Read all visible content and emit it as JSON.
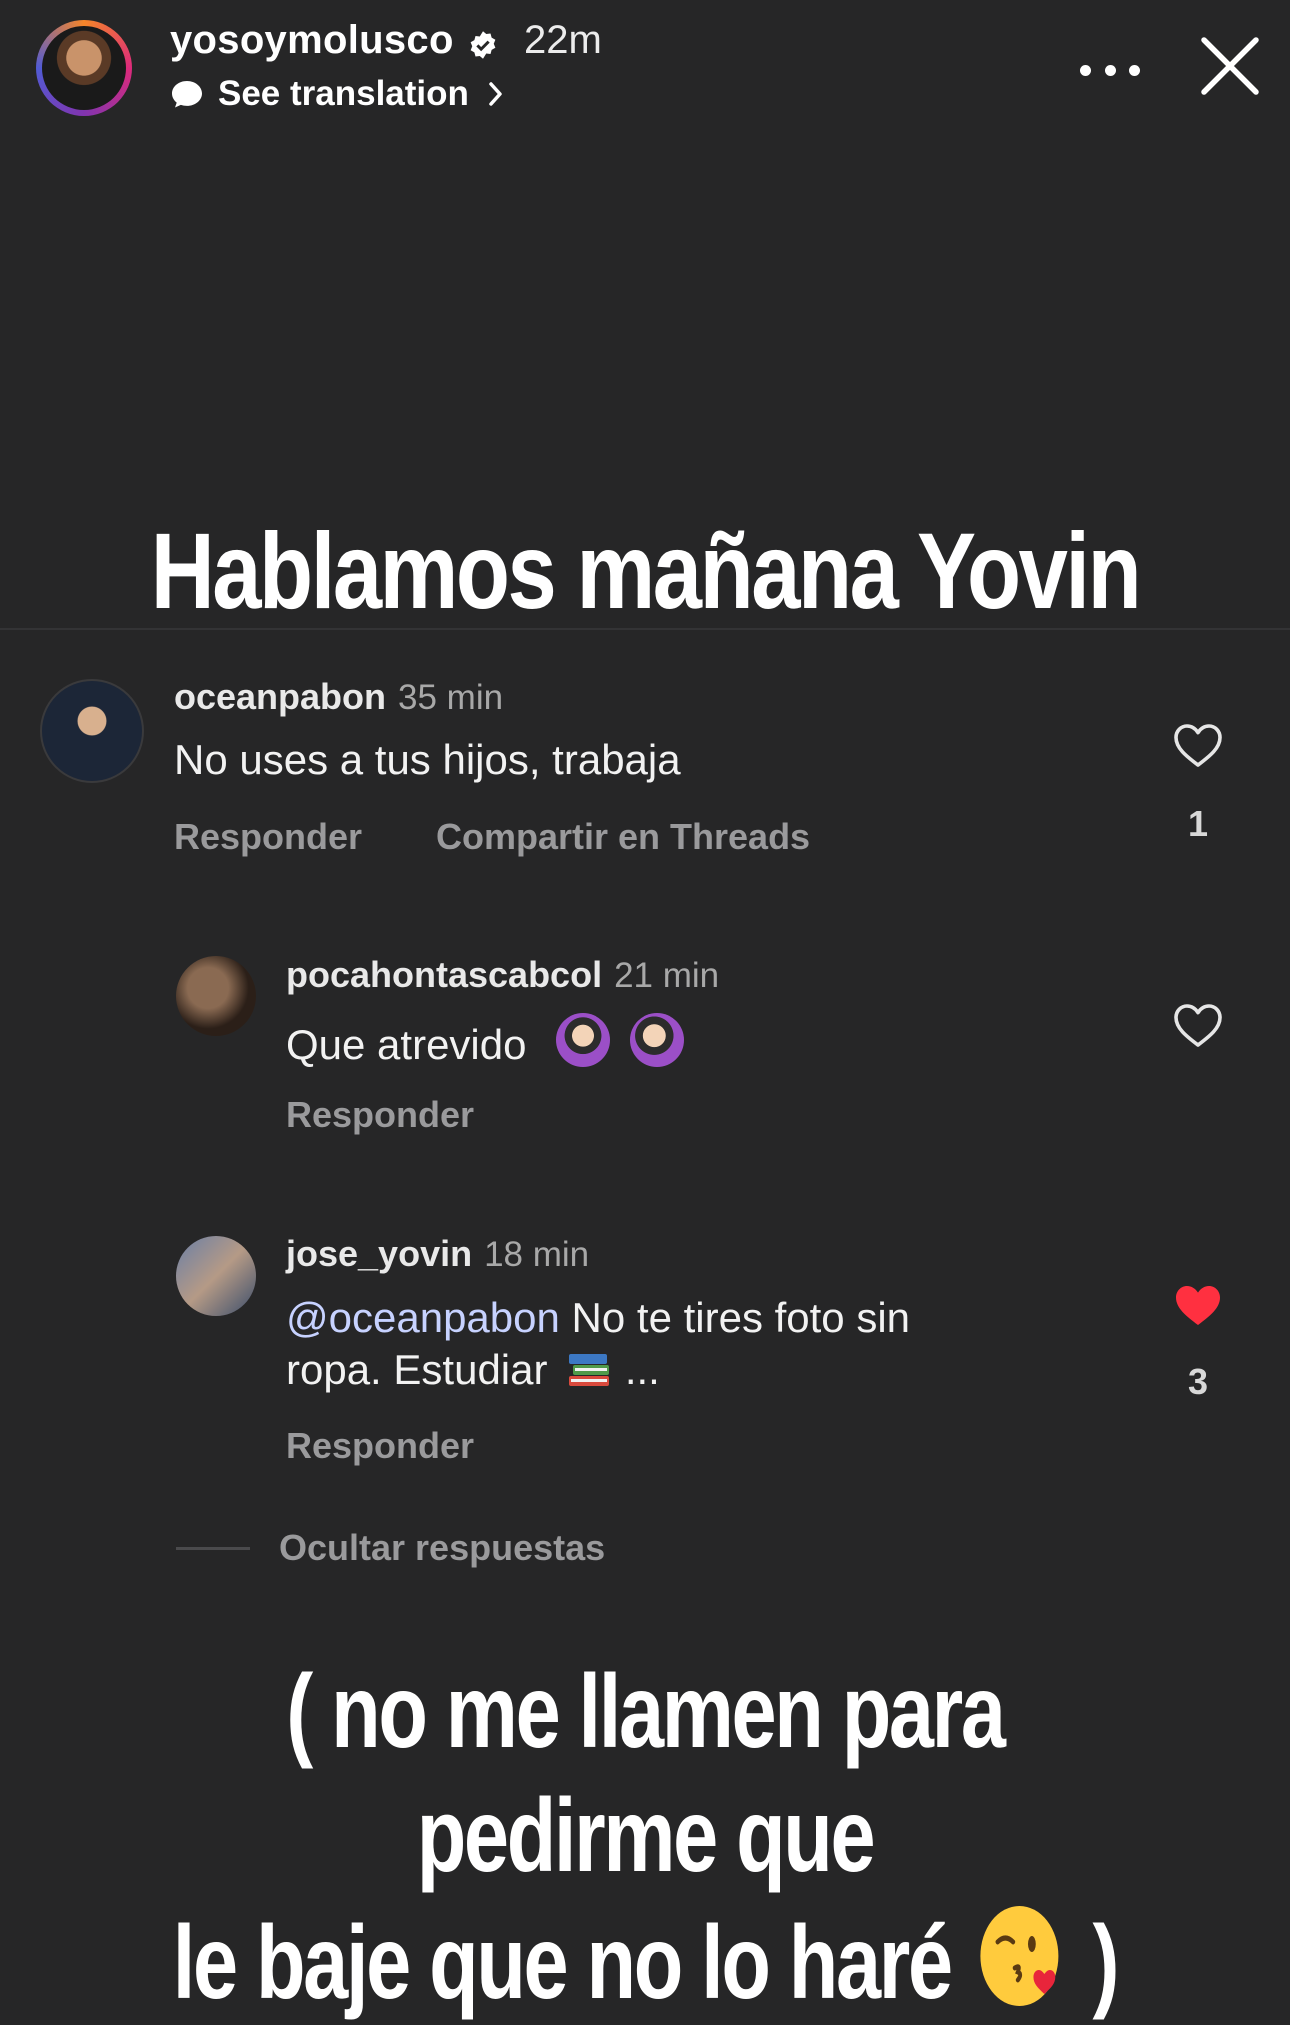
{
  "story": {
    "username": "yosoymolusco",
    "time": "22m",
    "translation": "See translation"
  },
  "headline": "Hablamos mañana Yovin",
  "comments": [
    {
      "username": "oceanpabon",
      "time": "35 min",
      "text": "No uses a tus hijos, trabaja",
      "actions": [
        "Responder",
        "Compartir en Threads"
      ],
      "likes": "1",
      "liked": false
    },
    {
      "username": "pocahontascabcol",
      "time": "21 min",
      "text": "Que atrevido",
      "emojis": [
        "woman-gesturing-ok-emoji",
        "woman-facepalming-emoji"
      ],
      "actions": [
        "Responder"
      ],
      "liked": false
    },
    {
      "username": "jose_yovin",
      "time": "18 min",
      "mention": "@oceanpabon",
      "text_line1": "No te tires foto sin",
      "text_line2": "ropa.  Estudiar",
      "text_suffix": "...",
      "emojis": [
        "books-emoji"
      ],
      "actions": [
        "Responder"
      ],
      "likes": "3",
      "liked": true
    }
  ],
  "hide_replies": "Ocultar respuestas",
  "caption": {
    "line1": "( no me llamen para pedirme que",
    "line2": "le baje que no lo haré",
    "closing": ")",
    "emoji": "kissing-face-with-heart-emoji"
  },
  "colors": {
    "background": "#262627",
    "like_red": "#ff3040",
    "mention": "#c7d2ff"
  }
}
